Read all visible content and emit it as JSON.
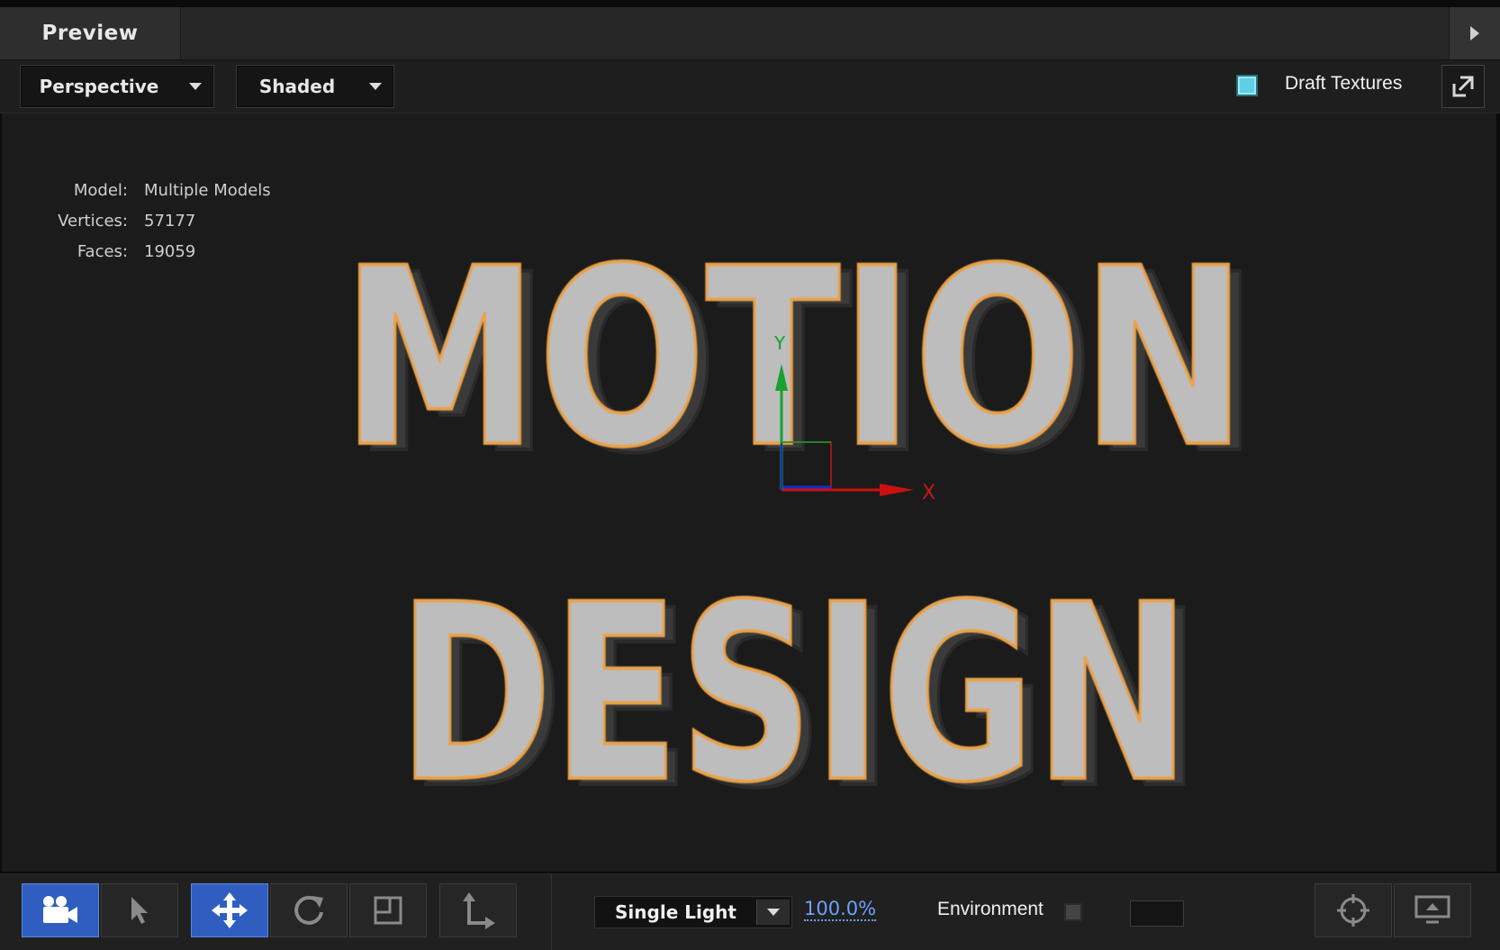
{
  "panel": {
    "tab_title": "Preview"
  },
  "toolbar": {
    "view_mode": "Perspective",
    "shading_mode": "Shaded",
    "draft_textures_label": "Draft Textures",
    "draft_textures_checked": true
  },
  "stats": [
    {
      "key": "Model:",
      "value": "Multiple Models"
    },
    {
      "key": "Vertices:",
      "value": "57177"
    },
    {
      "key": "Faces:",
      "value": "19059"
    }
  ],
  "scene": {
    "line1": "MOTION",
    "line2": "DESIGN",
    "axis_x_label": "X",
    "axis_y_label": "Y",
    "colors": {
      "face": "#bdbdbd",
      "edge": "#e8a24a",
      "extrude": "#3a3a3a",
      "axis_x": "#cc1010",
      "axis_y": "#18a030",
      "axis_z": "#1030d0"
    }
  },
  "bottom": {
    "tools": [
      "camera-icon",
      "select-arrow-icon",
      "move-icon",
      "rotate-icon",
      "scale-icon",
      "axis-icon"
    ],
    "lighting": "Single Light",
    "zoom": "100.0%",
    "environment_label": "Environment",
    "environment_checked": false
  },
  "accent": "#2f5ec0"
}
